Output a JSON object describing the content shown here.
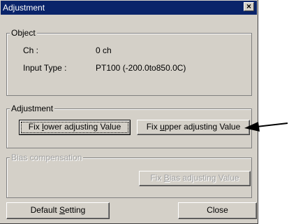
{
  "window": {
    "title": "Adjustment",
    "close_glyph": "×"
  },
  "object_group": {
    "legend": "Object",
    "ch_label": "Ch :",
    "ch_value": "0 ch",
    "input_type_label": "Input Type :",
    "input_type_value": "PT100 (-200.0to850.0C)"
  },
  "adjustment_group": {
    "legend": "Adjustment",
    "lower_button": {
      "pre": "Fix ",
      "accel": "l",
      "post": "ower adjusting Value"
    },
    "upper_button": {
      "pre": "Fix ",
      "accel": "u",
      "post": "pper adjusting Value"
    }
  },
  "bias_group": {
    "legend": "Bias compensation",
    "bias_button": {
      "pre": "Fix ",
      "accel": "B",
      "post": "ias adjusting Value"
    }
  },
  "footer": {
    "default_button": {
      "pre": "Default ",
      "accel": "S",
      "post": "etting"
    },
    "close_button": "Close"
  },
  "colors": {
    "title_bar": "#0a246a",
    "face": "#d4d0c8",
    "disabled_text": "#a0a0a0"
  }
}
